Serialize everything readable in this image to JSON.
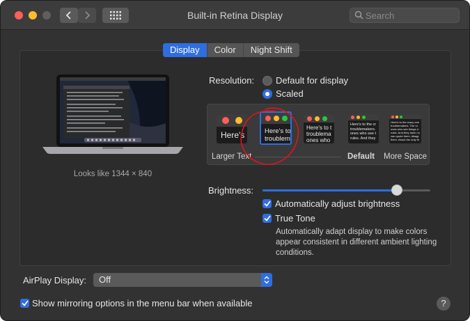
{
  "window": {
    "title": "Built-in Retina Display",
    "search_placeholder": "Search"
  },
  "tabs": [
    {
      "label": "Display",
      "active": true
    },
    {
      "label": "Color",
      "active": false
    },
    {
      "label": "Night Shift",
      "active": false
    }
  ],
  "preview": {
    "looks_like": "Looks like 1344 × 840"
  },
  "resolution": {
    "label": "Resolution:",
    "options": [
      {
        "label": "Default for display",
        "selected": false
      },
      {
        "label": "Scaled",
        "selected": true
      }
    ],
    "scale_thumbs": [
      {
        "text": "Here's",
        "selected": false
      },
      {
        "text": "Here's to\ntroublem",
        "selected": true
      },
      {
        "text": "Here's to t\ntroublema\nones who",
        "selected": false
      },
      {
        "text": "Here's to the cr\ntroublemakers.\nones who see t\nrules. And they",
        "selected": false
      },
      {
        "text": "Here's to the crazy one\ntroublemakers. The ro\nones who see things d\nrules. And they have no\ncan quote them, disagr\nthem. About the only th",
        "selected": false
      }
    ],
    "scale_labels": {
      "larger": "Larger Text",
      "default": "Default",
      "more": "More Space"
    }
  },
  "brightness": {
    "label": "Brightness:",
    "level": 0.8
  },
  "auto_brightness": {
    "label": "Automatically adjust brightness",
    "checked": true
  },
  "true_tone": {
    "label": "True Tone",
    "checked": true,
    "description": "Automatically adapt display to make colors appear consistent in different ambient lighting conditions."
  },
  "airplay": {
    "label": "AirPlay Display:",
    "value": "Off"
  },
  "mirroring": {
    "label": "Show mirroring options in the menu bar when available",
    "checked": true
  },
  "help": {
    "label": "?"
  },
  "colors": {
    "accent": "#2f6ee0",
    "annotation": "#e0141e"
  },
  "icons": [
    "chevron-left-icon",
    "chevron-right-icon",
    "grid-icon",
    "search-icon",
    "checkmark-icon",
    "updown-arrows-icon"
  ]
}
